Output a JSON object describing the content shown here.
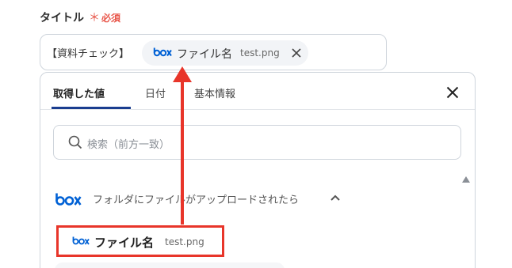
{
  "field": {
    "label": "タイトル",
    "required_mark": "＊",
    "required_text": "必須"
  },
  "title_input": {
    "prefix": "【資料チェック】",
    "chip": {
      "icon": "box-logo-icon",
      "label": "ファイル名",
      "value": "test.png",
      "close_icon": "close-icon"
    }
  },
  "panel": {
    "tabs": [
      {
        "label": "取得した値",
        "active": true
      },
      {
        "label": "日付",
        "active": false
      },
      {
        "label": "基本情報",
        "active": false
      }
    ],
    "search": {
      "placeholder": "検索（前方一致）"
    },
    "group": {
      "icon": "box-logo-icon",
      "label": "フォルダにファイルがアップロードされたら",
      "expanded": true
    },
    "items": [
      {
        "icon": "box-logo-icon",
        "label": "ファイル名",
        "value": "test.png",
        "highlighted": true
      }
    ]
  },
  "colors": {
    "accent": "#1a3d8f",
    "required": "#e8564a",
    "annotation": "#e8352a",
    "box_brand": "#0061d5"
  }
}
